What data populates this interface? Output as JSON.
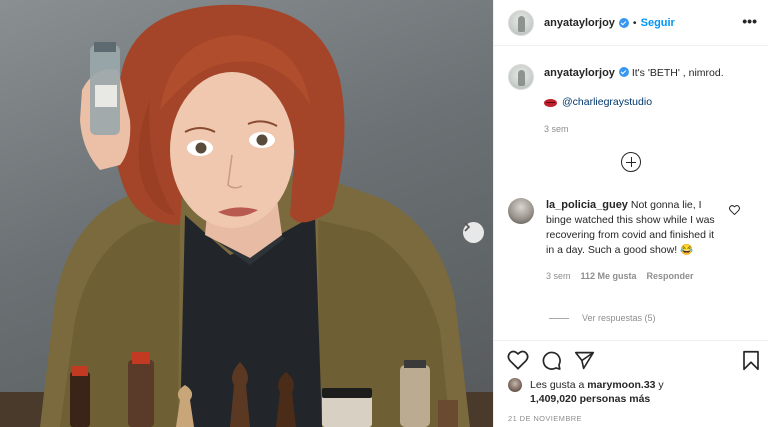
{
  "header": {
    "username": "anyataylorjoy",
    "separator": "•",
    "follow_label": "Seguir",
    "more_label": "•••"
  },
  "caption": {
    "username": "anyataylorjoy",
    "text": "It's 'BETH' , nimrod.",
    "mention": "@charliegraystudio",
    "time": "3 sem"
  },
  "comment": {
    "username": "la_policia_guey",
    "text": "Not gonna lie, I binge watched this show while I was recovering from covid and finished it in a day. Such a good show! 😂",
    "time": "3 sem",
    "likes": "112 Me gusta",
    "reply_label": "Responder",
    "view_replies": "Ver respuestas (5)"
  },
  "likes": {
    "prefix": "Les gusta a",
    "user": "marymoon.33",
    "middle": "y",
    "count": "1,409,020 personas más"
  },
  "post_date": "21 DE NOVIEMBRE",
  "icons": [
    "verified-badge-icon",
    "more-options-icon",
    "lips-emoji-icon",
    "add-comment-icon",
    "heart-icon",
    "comment-icon",
    "share-icon",
    "bookmark-icon",
    "chevron-right-icon"
  ],
  "colors": {
    "accent": "#0095f6",
    "verified": "#3897f0",
    "border": "#efefef",
    "meta": "#8e8e8e"
  }
}
